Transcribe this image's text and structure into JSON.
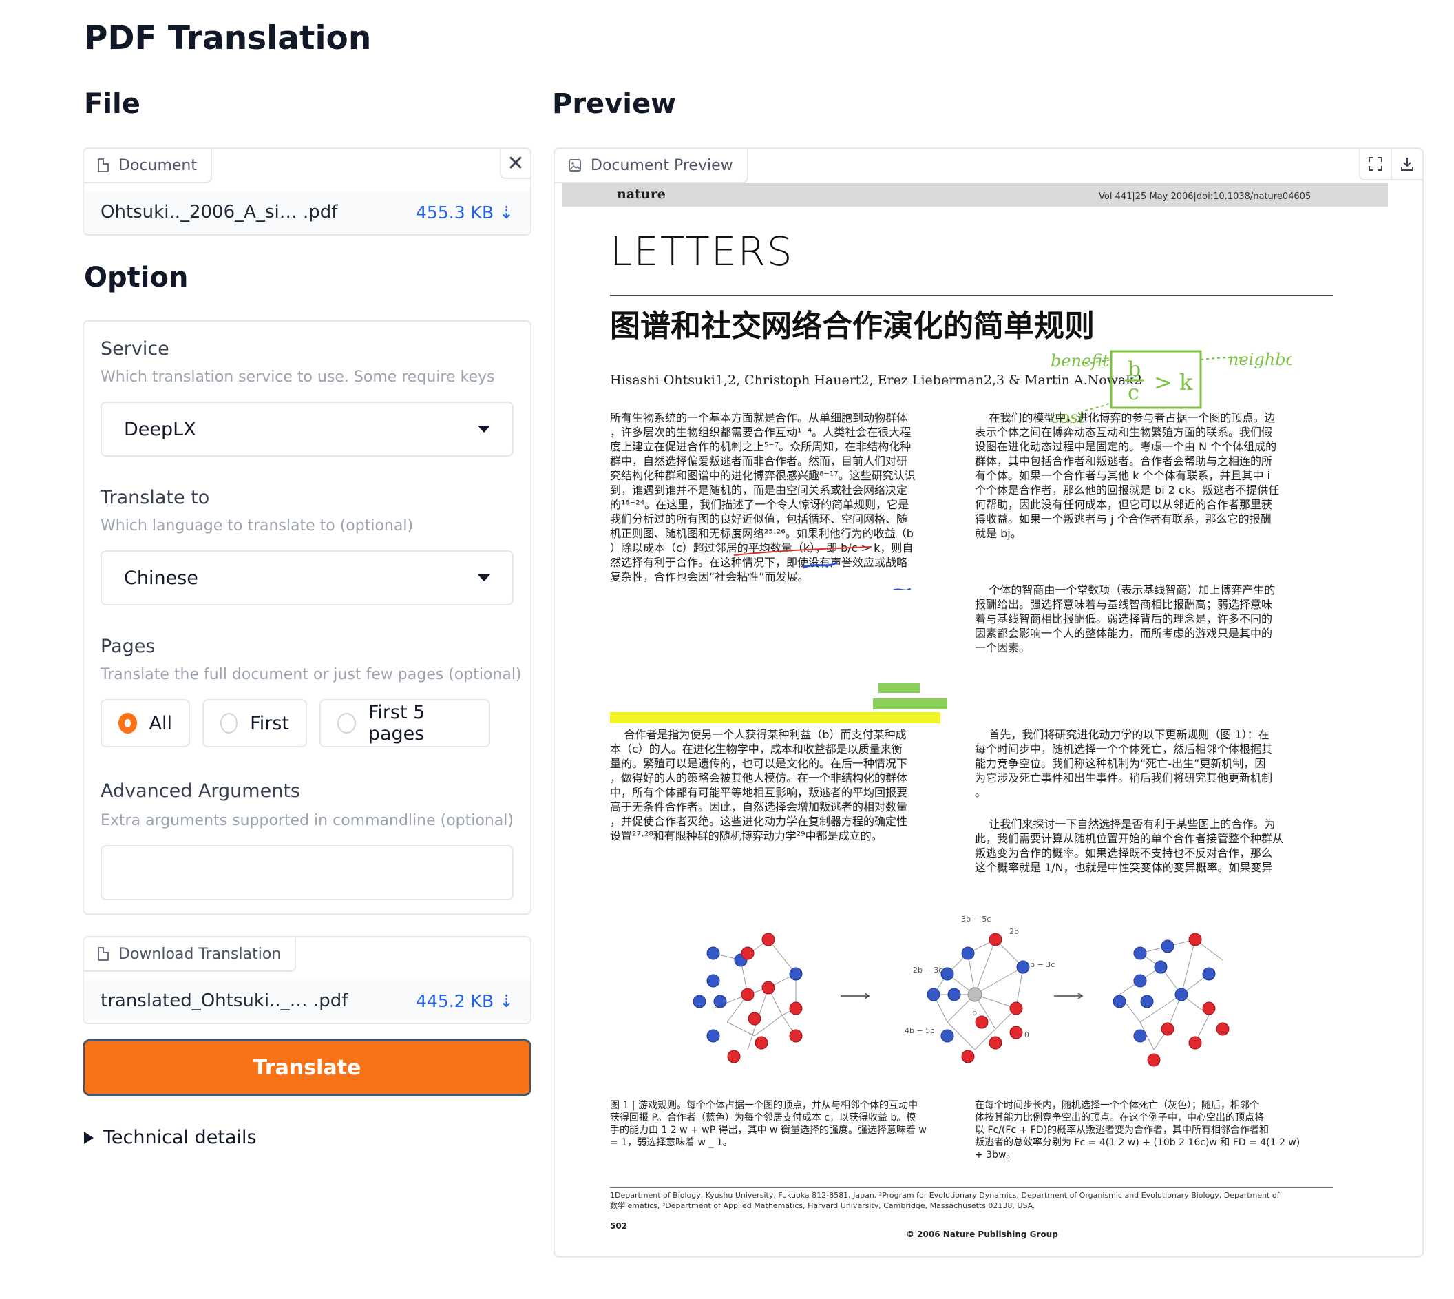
{
  "page": {
    "title": "PDF Translation"
  },
  "file": {
    "heading": "File",
    "document": {
      "label": "Document",
      "filename": "Ohtsuki.._2006_A_si…  .pdf",
      "size": "455.3 KB ⇣"
    }
  },
  "option": {
    "heading": "Option",
    "service": {
      "label": "Service",
      "info": "Which translation service to use. Some require keys",
      "value": "DeepLX"
    },
    "translate_to": {
      "label": "Translate to",
      "info": "Which language to translate to (optional)",
      "value": "Chinese"
    },
    "pages": {
      "label": "Pages",
      "info": "Translate the full document or just few pages (optional)",
      "options": [
        "All",
        "First",
        "First 5 pages"
      ],
      "selected": "All"
    },
    "advanced": {
      "label": "Advanced Arguments",
      "info": "Extra arguments supported in commandline (optional)",
      "value": ""
    }
  },
  "download": {
    "label": "Download Translation",
    "filename": "translated_Ohtsuki.._… .pdf",
    "size": "445.2 KB ⇣"
  },
  "translate_button": "Translate",
  "technical_details": "Technical details",
  "preview": {
    "heading": "Preview",
    "label": "Document Preview",
    "icons": [
      "fullscreen-icon",
      "download-icon"
    ],
    "doc": {
      "journal": "nature",
      "citation": "Vol 441|25 May 2006|doi:10.1038/nature04605",
      "section": "LETTERS",
      "title": "图谱和社交网络合作演化的简单规则",
      "authors": "Hisashi Ohtsuki1,2, Christoph Hauert2, Erez Lieberman2,3 & Martin A.Nowak2",
      "annotation_benefit": "benefit",
      "annotation_neighbor": "neighbor",
      "annotation_cost": "cost",
      "annotation_formula": "b/c > k",
      "col1_p1": "所有生物系统的一个基本方面就是合作。从单细胞到动物群体\n，许多层次的生物组织都需要合作互动¹⁻⁴。人类社会在很大程\n度上建立在促进合作的机制之上⁵⁻⁷。众所周知，在非结构化种\n群中，自然选择偏爱叛逃者而非合作者。然而，目前人们对研\n究结构化种群和图谱中的进化博弈很感兴趣⁸⁻¹⁷。这些研究认识\n到，谁遇到谁并不是随机的，而是由空间关系或社会网络决定\n的¹⁸⁻²⁴。在这里，我们描述了一个令人惊讶的简单规则，它是\n我们分析过的所有图的良好近似值，包括循环、空间网格、随\n机正则图、随机图和无标度网络²⁵·²⁶。如果利他行为的收益（b\n）除以成本（c）超过邻居的平均数量（k），即 b/c > k，则自\n然选择有利于合作。在这种情况下，即使没有声誉效应或战略\n复杂性，合作也会因“社会粘性”而发展。",
      "col1_p2": "    合作者是指为使另一个人获得某种利益（b）而支付某种成\n本（c）的人。在进化生物学中，成本和收益都是以质量来衡\n量的。繁殖可以是遗传的，也可以是文化的。在后一种情况下\n，做得好的人的策略会被其他人模仿。在一个非结构化的群体\n中，所有个体都有可能平等地相互影响，叛逃者的平均回报要\n高于无条件合作者。因此，自然选择会增加叛逃者的相对数量\n，并促使合作者灭绝。这些进化动力学在复制器方程的确定性\n设置²⁷·²⁸和有限种群的随机博弈动力学²⁹中都是成立的。",
      "col2_p1": "    在我们的模型中，进化博弈的参与者占据一个图的顶点。边\n表示个体之间在博弈动态互动和生物繁殖方面的联系。我们假\n设图在进化动态过程中是固定的。考虑一个由 N 个个体组成的\n群体，其中包括合作者和叛逃者。合作者会帮助与之相连的所\n有个体。如果一个合作者与其他 k 个个体有联系，并且其中 i\n个个体是合作者，那么他的回报就是 bi 2 ck。叛逃者不提供任\n何帮助，因此没有任何成本，但它可以从邻近的合作者那里获\n得收益。如果一个叛逃者与 j 个合作者有联系，那么它的报酬\n就是 bj。",
      "col2_p2": "    个体的智商由一个常数项（表示基线智商）加上博弈产生的\n报酬给出。强选择意味着与基线智商相比报酬高；弱选择意味\n着与基线智商相比报酬低。弱选择背后的理念是，许多不同的\n因素都会影响一个人的整体能力，而所考虑的游戏只是其中的\n一个因素。",
      "col2_p3": "    首先，我们将研究进化动力学的以下更新规则（图 1）：在\n每个时间步中，随机选择一个个体死亡，然后相邻个体根据其\n能力竞争空位。我们称这种机制为“死亡-出生”更新机制，因\n为它涉及死亡事件和出生事件。稍后我们将研究其他更新机制\n。",
      "col2_p4": "    让我们来探讨一下自然选择是否有利于某些图上的合作。为\n此，我们需要计算从随机位置开始的单个合作者接管整个种群从\n叛逃变为合作的概率。如果选择既不支持也不反对合作，那么\n这个概率就是 1/N，也就是中性突变体的变异概率。如果变异",
      "fig_labels": [
        "3b − 5c",
        "2b",
        "2b − 3c",
        "b − 3c",
        "4b − 5c",
        "b",
        "0"
      ],
      "caption_left": "图 1 | 游戏规则。每个个体占据一个图的顶点，并从与相邻个体的互动中\n获得回报 P。合作者（蓝色）为每个邻居支付成本 c，以获得收益 b。模\n手的能力由 1 2 w + wP 得出，其中 w 衡量选择的强度。强选择意味着 w\n= 1，弱选择意味着 w _ 1。",
      "caption_right": "在每个时间步长内，随机选择一个个体死亡（灰色）；随后，相邻个\n体按其能力比例竞争空出的顶点。在这个例子中，中心空出的顶点将\n以 Fc/(Fc + FD)的概率从叛逃者变为合作者，其中所有相邻合作者和\n叛逃者的总效率分别为 Fc = 4(1 2 w) + (10b 2 16c)w 和 FD = 4(1 2 w)\n+ 3bw。",
      "footnote": "1Department of Biology, Kyushu University, Fukuoka 812-8581, Japan. ²Program for Evolutionary Dynamics, Department of Organismic and Evolutionary Biology, Department of\n数学 ematics, ³Department of Applied Mathematics, Harvard University, Cambridge, Massachusetts 02138, USA.",
      "page_number": "502",
      "copyright": "© 2006 Nature Publishing Group"
    }
  },
  "colors": {
    "accent": "#f97316",
    "link": "#2563eb",
    "border": "#e5e7eb"
  }
}
